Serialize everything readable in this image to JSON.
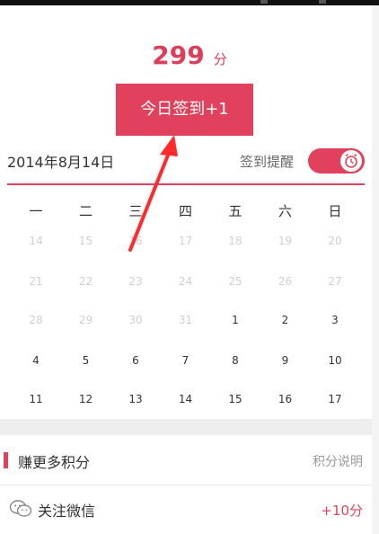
{
  "header": {
    "points": "299",
    "points_unit": "分"
  },
  "checkin_button": {
    "label": "今日签到+1"
  },
  "date_row": {
    "date": "2014年8月14日",
    "reminder_label": "签到提醒",
    "reminder_on": true
  },
  "calendar": {
    "weekdays": [
      "一",
      "二",
      "三",
      "四",
      "五",
      "六",
      "日"
    ],
    "weeks": [
      [
        {
          "d": "14",
          "m": true
        },
        {
          "d": "15",
          "m": true
        },
        {
          "d": "16",
          "m": true
        },
        {
          "d": "17",
          "m": true
        },
        {
          "d": "18",
          "m": true
        },
        {
          "d": "19",
          "m": true
        },
        {
          "d": "20",
          "m": true
        }
      ],
      [
        {
          "d": "21",
          "m": true
        },
        {
          "d": "22",
          "m": true
        },
        {
          "d": "23",
          "m": true
        },
        {
          "d": "24",
          "m": true
        },
        {
          "d": "25",
          "m": true
        },
        {
          "d": "26",
          "m": true
        },
        {
          "d": "27",
          "m": true
        }
      ],
      [
        {
          "d": "28",
          "m": true
        },
        {
          "d": "29",
          "m": true
        },
        {
          "d": "30",
          "m": true
        },
        {
          "d": "31",
          "m": true
        },
        {
          "d": "1",
          "m": false
        },
        {
          "d": "2",
          "m": false
        },
        {
          "d": "3",
          "m": false
        }
      ],
      [
        {
          "d": "4",
          "m": false
        },
        {
          "d": "5",
          "m": false
        },
        {
          "d": "6",
          "m": false
        },
        {
          "d": "7",
          "m": false
        },
        {
          "d": "8",
          "m": false
        },
        {
          "d": "9",
          "m": false
        },
        {
          "d": "10",
          "m": false
        }
      ],
      [
        {
          "d": "11",
          "m": false
        },
        {
          "d": "12",
          "m": false
        },
        {
          "d": "13",
          "m": false
        },
        {
          "d": "14",
          "m": false
        },
        {
          "d": "15",
          "m": false
        },
        {
          "d": "16",
          "m": false
        },
        {
          "d": "17",
          "m": false
        }
      ]
    ]
  },
  "earn_section": {
    "title": "赚更多积分",
    "help_link": "积分说明"
  },
  "tasks": [
    {
      "title": "关注微信",
      "reward": "+10分",
      "icon": "wechat-icon"
    }
  ],
  "colors": {
    "accent": "#e1415c"
  }
}
